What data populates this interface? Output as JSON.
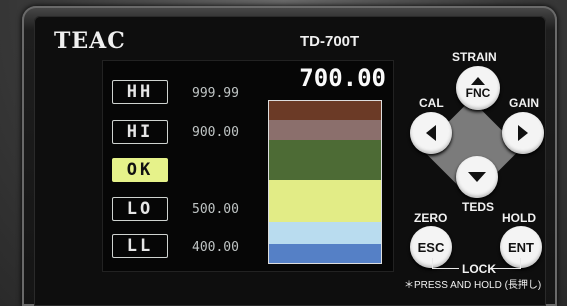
{
  "device": {
    "brand": "TEAC",
    "model": "TD-700T"
  },
  "display": {
    "reading": "700.00",
    "levels": [
      {
        "tag": "HH",
        "threshold": "999.99",
        "active": false
      },
      {
        "tag": "HI",
        "threshold": "900.00",
        "active": false
      },
      {
        "tag": "OK",
        "threshold": "",
        "active": true
      },
      {
        "tag": "LO",
        "threshold": "500.00",
        "active": false
      },
      {
        "tag": "LL",
        "threshold": "400.00",
        "active": false
      }
    ],
    "bar_colors": [
      "#6b3a26",
      "#8b6f6c",
      "#4d6b35",
      "#e2ec86",
      "#b9dcef",
      "#5580c6"
    ]
  },
  "keypad": {
    "fnc_label": "FNC",
    "esc_label": "ESC",
    "ent_label": "ENT",
    "top_label": "STRAIN",
    "left_label": "CAL",
    "right_label": "GAIN",
    "bottom_label": "TEDS",
    "zero_label": "ZERO",
    "hold_label": "HOLD",
    "lock_label": "LOCK",
    "note": "＊PRESS AND HOLD (長押し)"
  },
  "colors": {
    "ok_highlight": "#e6f28a",
    "button": "#f4f4f4"
  }
}
